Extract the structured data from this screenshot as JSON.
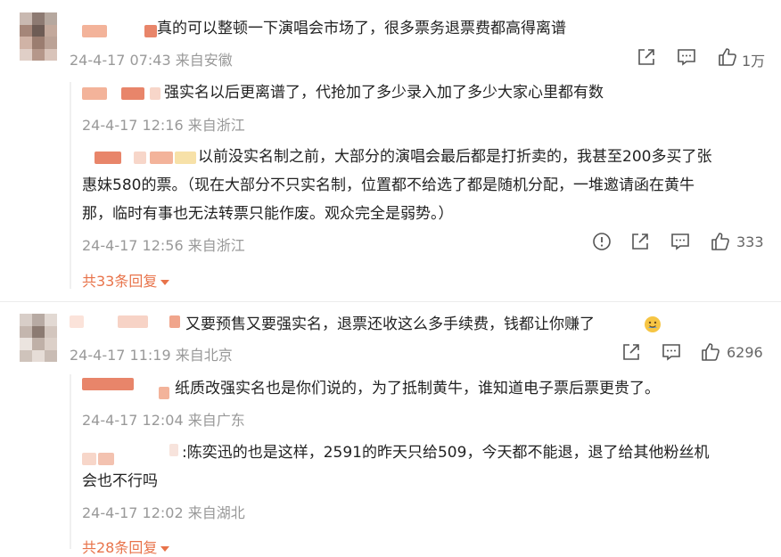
{
  "comments": [
    {
      "text": "真的可以整顿一下演唱会市场了，很多票务退票费都高得离谱",
      "meta": "24-4-17 07:43 来自安徽",
      "likes": "1万",
      "replies": [
        {
          "text": "强实名以后更离谱了，代抢加了多少录入加了多少大家心里都有数",
          "meta": "24-4-17 12:16 来自浙江"
        },
        {
          "text_lines": [
            "以前没实名制之前，大部分的演唱会最后都是打折卖的，我甚至200多买了张",
            "惠妹580的票。（现在大部分不只实名制，位置都不给选了都是随机分配，一堆邀请函在黄牛",
            "那，临时有事也无法转票只能作废。观众完全是弱势。）"
          ],
          "meta": "24-4-17 12:56 来自浙江",
          "likes": "333"
        }
      ],
      "more": "共33条回复"
    },
    {
      "text": "又要预售又要强实名，退票还收这么多手续费，钱都让你赚了",
      "meta": "24-4-17 11:19 来自北京",
      "likes": "6296",
      "replies": [
        {
          "text": "纸质改强实名也是你们说的，为了抵制黄牛，谁知道电子票后票更贵了。",
          "meta": "24-4-17 12:04 来自广东"
        },
        {
          "text_lines": [
            ":陈奕迅的也是这样，2591的昨天只给509，今天都不能退，退了给其他粉丝机",
            "会也不行吗"
          ],
          "meta": "24-4-17 12:02 来自湖北"
        }
      ],
      "more": "共28条回复"
    }
  ],
  "icons": {
    "share": "share-icon",
    "comment": "comment-icon",
    "like": "thumbs-up-icon",
    "report": "report-icon",
    "emoji": "smile-emoji-icon"
  },
  "colors": {
    "link": "#e8734a",
    "meta": "#999999",
    "thread_line": "#f0f0f0"
  }
}
